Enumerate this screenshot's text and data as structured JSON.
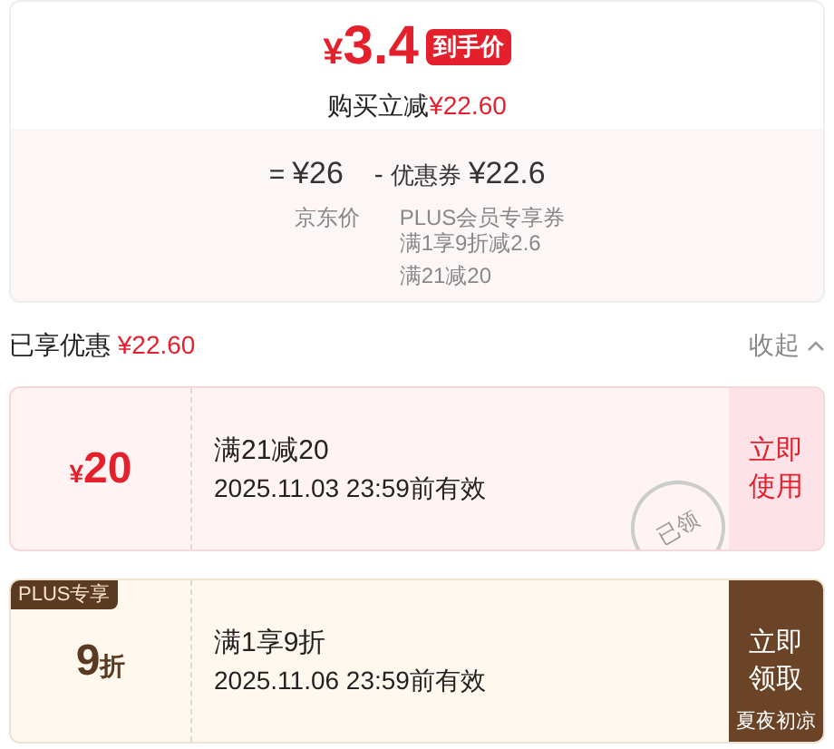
{
  "summary": {
    "currency": "¥",
    "price": "3.4",
    "badge": "到手价",
    "saving_label": "购买立减",
    "saving": "¥22.60"
  },
  "breakdown": {
    "items": [
      {
        "op": "=",
        "amount": "¥26",
        "groups": [
          [
            "京东价"
          ]
        ]
      },
      {
        "op": "-",
        "amount": "¥22.6",
        "prefix": "优惠券",
        "groups": [
          [
            "PLUS会员专享券",
            "满1享9折减2.6"
          ],
          [
            "满21减20"
          ]
        ]
      }
    ]
  },
  "enjoyed": {
    "label": "已享优惠",
    "amount": "¥22.60",
    "toggle": "收起"
  },
  "coupons": [
    {
      "kind": "red",
      "amount_prefix": "¥",
      "amount": "20",
      "title": "满21减20",
      "validity": "2025.11.03 23:59前有效",
      "action": "立即使用",
      "claimed": true,
      "stamp": "已领"
    },
    {
      "kind": "plus",
      "tag": "PLUS专享",
      "amount": "9",
      "amount_suffix": "折",
      "title": "满1享9折",
      "validity": "2025.11.06 23:59前有效",
      "action": "立即领取",
      "footer": "夏夜初凉",
      "claimed": false
    }
  ]
}
